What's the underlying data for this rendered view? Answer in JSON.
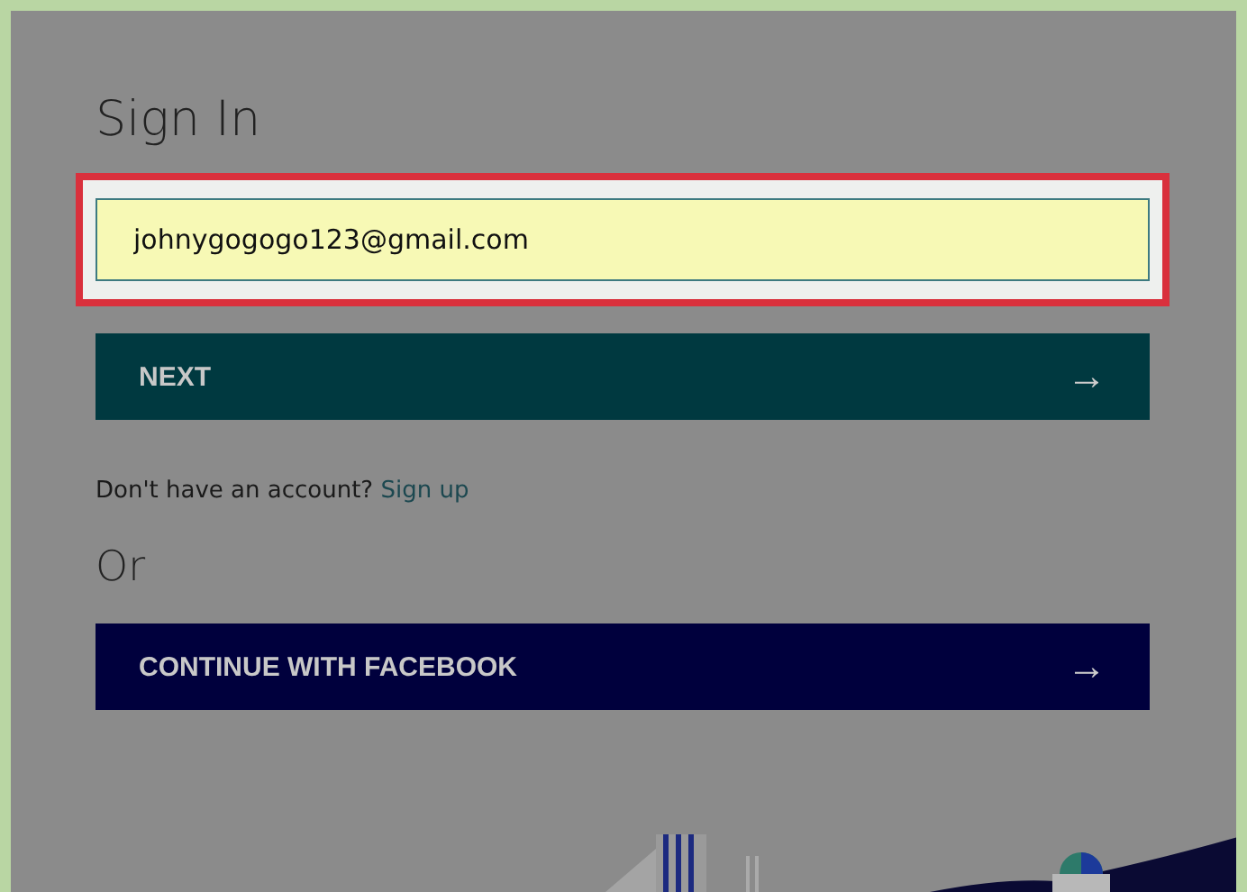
{
  "title": "Sign In",
  "email_field": {
    "value": "johnygogogo123@gmail.com",
    "highlighted": true
  },
  "next_button": {
    "label": "NEXT",
    "arrow": "→"
  },
  "signup_prompt": {
    "text": "Don't have an account?",
    "link": "Sign up"
  },
  "or_label": "Or",
  "facebook_button": {
    "label": "CONTINUE WITH FACEBOOK",
    "arrow": "→"
  }
}
